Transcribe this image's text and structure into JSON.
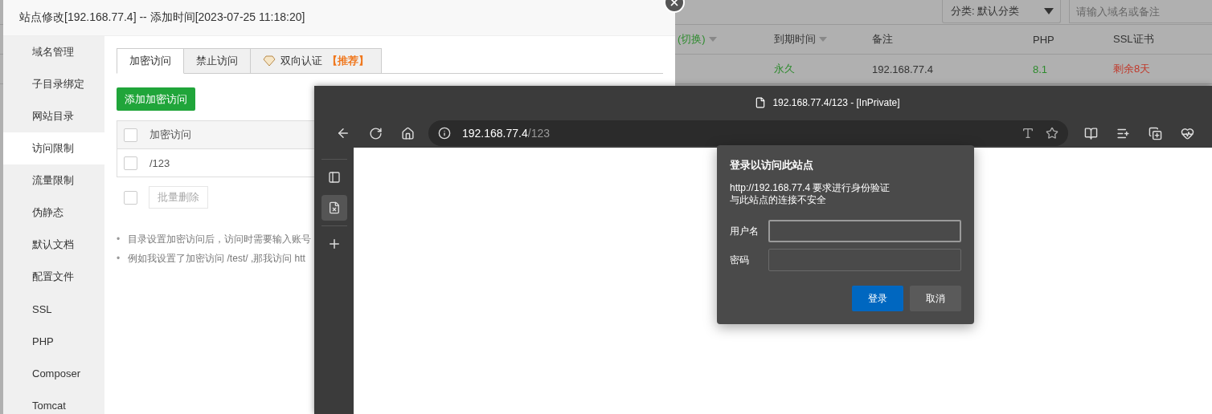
{
  "background_page": {
    "category_select": {
      "value": "分类: 默认分类"
    },
    "search": {
      "placeholder": "请输入域名或备注"
    },
    "columns": [
      {
        "label": "(切换)",
        "sortable": true,
        "color": "#2e8b2e"
      },
      {
        "label": "到期时间",
        "sortable": true,
        "color": "#333333"
      },
      {
        "label": "备注",
        "sortable": false,
        "color": "#333333"
      },
      {
        "label": "PHP",
        "sortable": false,
        "color": "#333333"
      },
      {
        "label": "SSL证书",
        "sortable": false,
        "color": "#333333"
      }
    ],
    "rows": [
      {
        "cells": [
          {
            "text": ""
          },
          {
            "text": "永久",
            "color": "#2e8b2e"
          },
          {
            "text": "192.168.77.4",
            "color": "#333333"
          },
          {
            "text": "8.1",
            "color": "#2e8b2e"
          },
          {
            "text": "剩余8天",
            "color": "#c0392b"
          }
        ]
      }
    ]
  },
  "modal": {
    "title": "站点修改[192.168.77.4] -- 添加时间[2023-07-25 11:18:20]",
    "sidebar": {
      "items": [
        {
          "label": "域名管理",
          "selected": false
        },
        {
          "label": "子目录绑定",
          "selected": false
        },
        {
          "label": "网站目录",
          "selected": false
        },
        {
          "label": "访问限制",
          "selected": true
        },
        {
          "label": "流量限制",
          "selected": false
        },
        {
          "label": "伪静态",
          "selected": false
        },
        {
          "label": "默认文档",
          "selected": false
        },
        {
          "label": "配置文件",
          "selected": false
        },
        {
          "label": "SSL",
          "selected": false
        },
        {
          "label": "PHP",
          "selected": false
        },
        {
          "label": "Composer",
          "selected": false
        },
        {
          "label": "Tomcat",
          "selected": false
        }
      ]
    },
    "tabs": [
      {
        "label": "加密访问",
        "kind": "plain",
        "selected": true
      },
      {
        "label": "禁止访问",
        "kind": "plain",
        "selected": false
      },
      {
        "label": "双向认证",
        "badge": "【推荐】",
        "kind": "premium",
        "selected": false
      }
    ],
    "add_button": "添加加密访问",
    "table": {
      "column": "加密访问",
      "header_checked": false,
      "rows": [
        {
          "path": "/123",
          "checked": false
        }
      ]
    },
    "bulk": {
      "checked": false,
      "button": {
        "label": "批量删除",
        "disabled": true
      }
    },
    "notes": [
      {
        "marker": "•",
        "text": "目录设置加密访问后，访问时需要输入账号"
      },
      {
        "marker": "•",
        "text": "例如我设置了加密访问 /test/ ,那我访问 htt"
      }
    ]
  },
  "browser": {
    "title": "192.168.77.4/123 - [InPrivate]",
    "address": {
      "host": "192.168.77.4",
      "path": "/123"
    },
    "dialog": {
      "title": "登录以访问此站点",
      "lines": [
        "http://192.168.77.4 要求进行身份验证",
        "与此站点的连接不安全"
      ],
      "fields": [
        {
          "label": "用户名",
          "focused": true
        },
        {
          "label": "密码",
          "focused": false
        }
      ],
      "buttons": [
        {
          "label": "登录",
          "kind": "primary"
        },
        {
          "label": "取消",
          "kind": "secondary"
        }
      ]
    }
  }
}
